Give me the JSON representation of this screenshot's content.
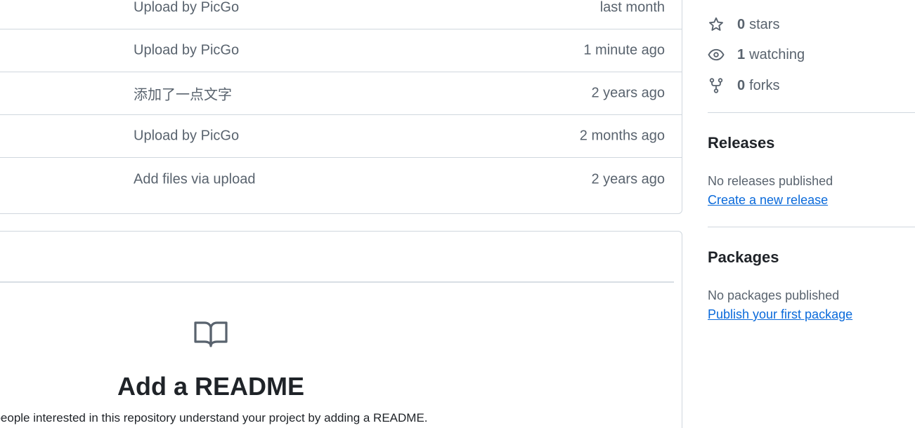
{
  "files": {
    "rows": [
      {
        "message": "Upload by PicGo",
        "age": "last month"
      },
      {
        "message": "Upload by PicGo",
        "age": "1 minute ago"
      },
      {
        "message": "添加了一点文字",
        "age": "2 years ago"
      },
      {
        "message": "Upload by PicGo",
        "age": "2 months ago"
      },
      {
        "message": "Add files via upload",
        "age": "2 years ago"
      }
    ]
  },
  "readme": {
    "icon": "book-icon",
    "title": "Add a README",
    "description": "people interested in this repository understand your project by adding a README."
  },
  "sidebar": {
    "stars": {
      "count": "0",
      "label": "stars",
      "icon": "star-icon"
    },
    "watching": {
      "count": "1",
      "label": "watching",
      "icon": "eye-icon"
    },
    "forks": {
      "count": "0",
      "label": "forks",
      "icon": "fork-icon"
    },
    "releases": {
      "heading": "Releases",
      "empty_text": "No releases published",
      "link": "Create a new release"
    },
    "packages": {
      "heading": "Packages",
      "empty_text": "No packages published",
      "link": "Publish your first package"
    }
  },
  "colors": {
    "muted_text": "#59636e",
    "link": "#0969da",
    "border": "#d0d7de",
    "heading": "#1f2328"
  }
}
